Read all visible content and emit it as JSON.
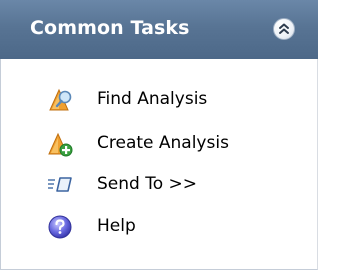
{
  "panel": {
    "title": "Common Tasks",
    "collapse_icon": "double-chevron-up-icon",
    "header_color": "#5a7697"
  },
  "items": [
    {
      "label": "Find Analysis",
      "icon": "find-analysis-icon"
    },
    {
      "label": "Create Analysis",
      "icon": "create-analysis-icon"
    },
    {
      "label": "Send To >>",
      "icon": "send-to-icon"
    },
    {
      "label": "Help",
      "icon": "help-icon"
    }
  ]
}
